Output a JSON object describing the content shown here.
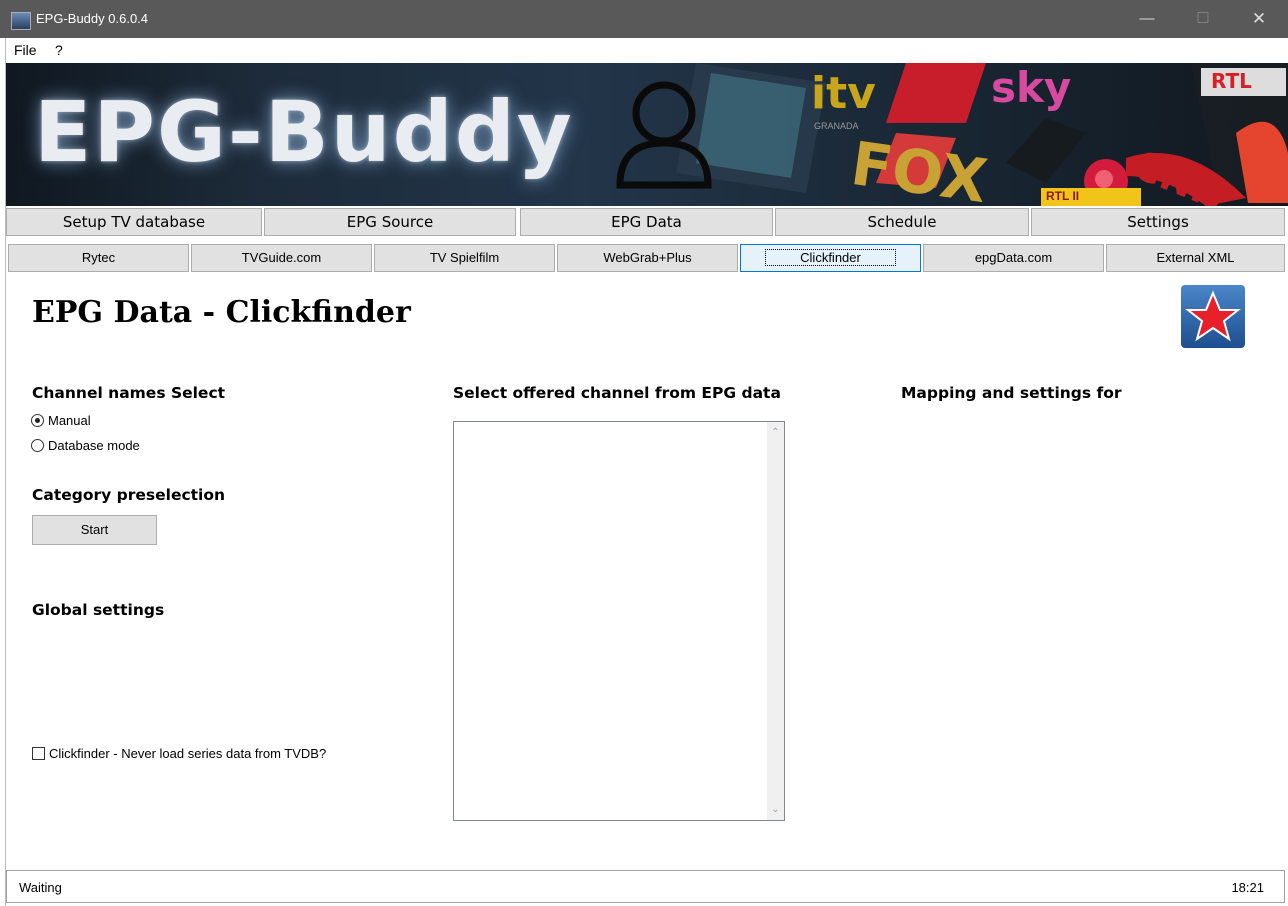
{
  "window": {
    "title": "EPG-Buddy 0.6.0.4",
    "minimize": "—",
    "maximize": "☐",
    "close": "✕"
  },
  "menu": {
    "file": "File",
    "help": "?"
  },
  "banner": {
    "title": "EPG-Buddy",
    "logos": [
      "itv",
      "GRANADA",
      "FOX",
      "sky",
      "RTL II",
      "RTL",
      "CNN"
    ]
  },
  "main_tabs": [
    "Setup TV database",
    "EPG Source",
    "EPG Data",
    "Schedule",
    "Settings"
  ],
  "sub_tabs": [
    "Rytec",
    "TVGuide.com",
    "TV Spielfilm",
    "WebGrab+Plus",
    "Clickfinder",
    "epgData.com",
    "External XML"
  ],
  "active_sub_tab": "Clickfinder",
  "page": {
    "title": "EPG Data - Clickfinder",
    "channel_names": {
      "heading": "Channel names Select",
      "manual": "Manual",
      "database": "Database mode",
      "selected": "Manual"
    },
    "category": {
      "heading": "Category preselection",
      "start": "Start"
    },
    "global": {
      "heading": "Global settings"
    },
    "never_load": {
      "label": "Clickfinder - Never load series data from TVDB?",
      "checked": false
    },
    "offered": {
      "heading": "Select offered channel from EPG data"
    },
    "mapping": {
      "heading": "Mapping and settings for"
    }
  },
  "status": {
    "text": "Waiting",
    "time": "18:21"
  },
  "colors": {
    "titlebar": "#595959",
    "active_tab_border": "#0078d7",
    "star": "#e8202a"
  }
}
